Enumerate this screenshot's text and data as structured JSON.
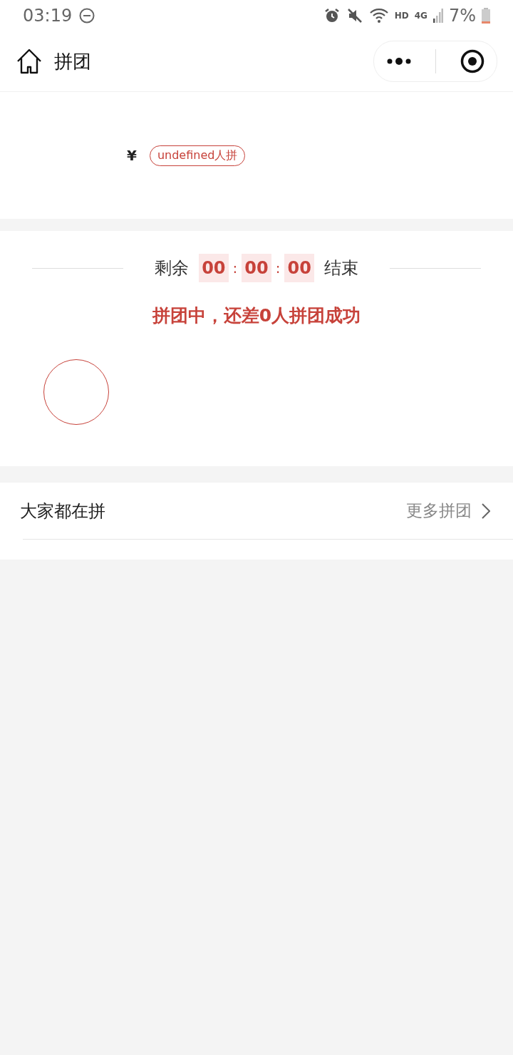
{
  "status_bar": {
    "time": "03:19",
    "network": "HD",
    "cellular": "4G",
    "battery": "7%"
  },
  "nav": {
    "title": "拼团"
  },
  "product": {
    "currency": "¥",
    "group_tag": "undefined人拼"
  },
  "countdown": {
    "prefix": "剩余",
    "hours": "00",
    "minutes": "00",
    "seconds": "00",
    "separator": ":",
    "suffix": "结束"
  },
  "group_status": "拼团中，还差0人拼团成功",
  "members": [
    {
      "kind": "empty"
    }
  ],
  "others": {
    "title": "大家都在拼",
    "more": "更多拼团"
  }
}
